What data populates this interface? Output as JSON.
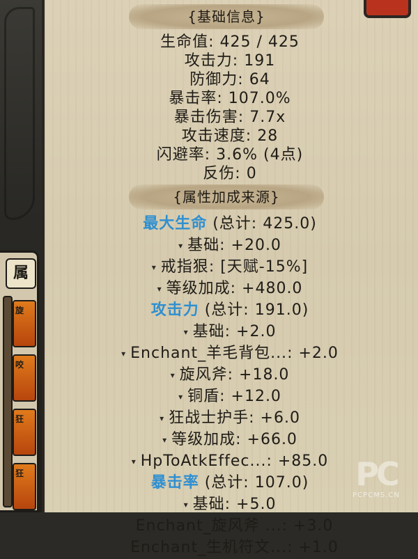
{
  "basic_info": {
    "header": "{基础信息}",
    "stats": [
      {
        "label": "生命值",
        "value": "425 / 425"
      },
      {
        "label": "攻击力",
        "value": "191"
      },
      {
        "label": "防御力",
        "value": "64"
      },
      {
        "label": "暴击率",
        "value": "107.0%"
      },
      {
        "label": "暴击伤害",
        "value": "7.7x"
      },
      {
        "label": "攻击速度",
        "value": "28"
      },
      {
        "label": "闪避率",
        "value": "3.6% (4点)"
      },
      {
        "label": "反伤",
        "value": "0"
      }
    ]
  },
  "bonus_sources": {
    "header": "{属性加成来源}",
    "groups": [
      {
        "name": "最大生命",
        "total": "(总计: 425.0)",
        "items": [
          {
            "label": "基础",
            "value": "+20.0"
          },
          {
            "label": "戒指狠",
            "value": "[天赋-15%]"
          },
          {
            "label": "等级加成",
            "value": "+480.0"
          }
        ]
      },
      {
        "name": "攻击力",
        "total": "(总计: 191.0)",
        "items": [
          {
            "label": "基础",
            "value": "+2.0"
          },
          {
            "label": "Enchant_羊毛背包...",
            "value": "+2.0"
          },
          {
            "label": "旋风斧",
            "value": "+18.0"
          },
          {
            "label": "铜盾",
            "value": "+12.0"
          },
          {
            "label": "狂战士护手",
            "value": "+6.0"
          },
          {
            "label": "等级加成",
            "value": "+66.0"
          },
          {
            "label": "HpToAtkEffec...",
            "value": "+85.0"
          }
        ]
      },
      {
        "name": "暴击率",
        "total": "(总计: 107.0)",
        "items": [
          {
            "label": "基础",
            "value": "+5.0"
          },
          {
            "label": "Enchant_旋风斧 ...",
            "value": "+3.0"
          },
          {
            "label": "Enchant_生机符文...",
            "value": "+1.0"
          }
        ]
      }
    ]
  },
  "side_panel": {
    "tab_label": "属",
    "items": [
      "旋",
      "咬",
      "狂",
      "狂"
    ]
  },
  "watermark": {
    "logo": "PC",
    "site": "PCPCMS.CN"
  },
  "colors": {
    "parchment": "#d9ceb2",
    "highlight": "#2f8fd0",
    "text": "#1f1c17",
    "accent_red": "#b9321e"
  }
}
